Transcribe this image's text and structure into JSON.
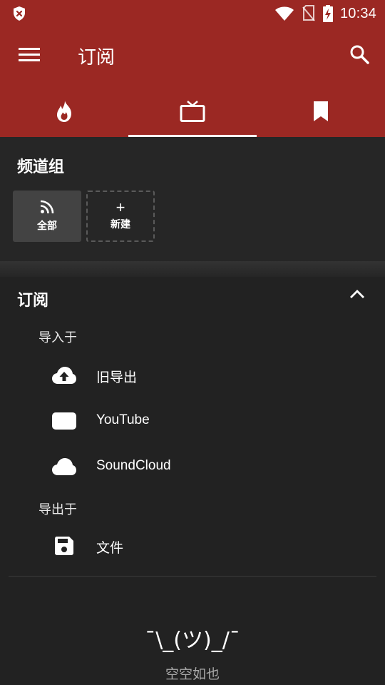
{
  "status_bar": {
    "time": "10:34",
    "icons": [
      "shield-x-icon",
      "wifi-icon",
      "no-sim-icon",
      "battery-charging-icon"
    ]
  },
  "app_bar": {
    "title": "订阅",
    "menu_icon": "hamburger-menu-icon",
    "search_icon": "search-icon"
  },
  "tabs": [
    {
      "icon": "fire-icon",
      "selected": false
    },
    {
      "icon": "tv-icon",
      "selected": true
    },
    {
      "icon": "bookmark-icon",
      "selected": false
    }
  ],
  "channel_groups": {
    "heading": "频道组",
    "items": [
      {
        "label": "全部",
        "icon": "rss-icon"
      },
      {
        "label": "新建",
        "icon": "plus-icon",
        "plus": "+"
      }
    ]
  },
  "subscriptions": {
    "heading": "订阅",
    "collapse_icon": "chevron-up-icon",
    "import_label": "导入于",
    "import_items": [
      {
        "label": "旧导出",
        "icon": "cloud-upload-icon"
      },
      {
        "label": "YouTube",
        "icon": "youtube-icon"
      },
      {
        "label": "SoundCloud",
        "icon": "cloud-icon"
      }
    ],
    "export_label": "导出于",
    "export_items": [
      {
        "label": "文件",
        "icon": "save-icon"
      }
    ]
  },
  "empty_state": {
    "emoticon": "¯\\_(ツ)_/¯",
    "text": "空空如也"
  },
  "colors": {
    "primary": "#9b2823",
    "background": "#222222",
    "surface": "#262626",
    "chip": "#434343",
    "text": "#ffffff",
    "muted_text": "#a9a9a9"
  }
}
